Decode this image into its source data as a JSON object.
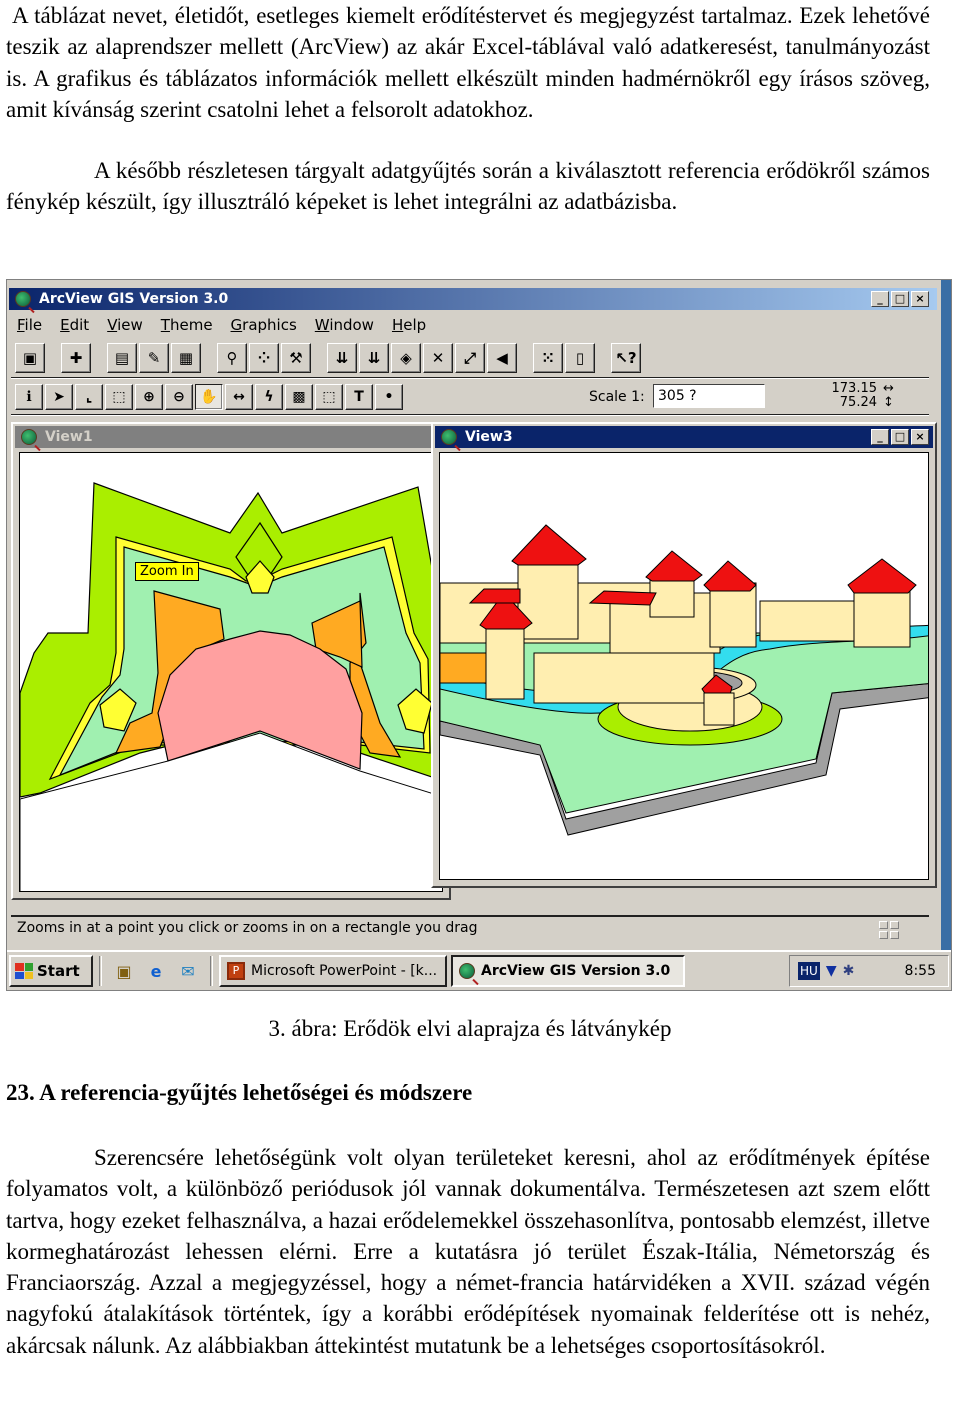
{
  "document": {
    "paragraph1": "A táblázat nevet, életidőt, esetleges kiemelt erődítéstervet és megjegyzést tartalmaz. Ezek lehetővé teszik az alaprendszer mellett (ArcView) az akár Excel-táblával való adatkeresést, tanulmányozást is. A grafikus és táblázatos információk mellett elkészült minden hadmérnökről egy írásos szöveg, amit kívánság szerint csatolni lehet a felsorolt adatokhoz.",
    "paragraph2": "A később részletesen tárgyalt adatgyűjtés során a kiválasztott referencia erődökről számos fénykép készült, így illusztráló képeket is lehet integrálni az adatbázisba.",
    "figure_caption": "3. ábra: Erődök elvi alaprajza és látványkép",
    "section_title": "23. A referencia-gyűjtés lehetőségei és módszere",
    "paragraph3": "Szerencsére lehetőségünk volt olyan területeket keresni, ahol az erődítmények építése folyamatos volt, a különböző periódusok jól vannak dokumentálva. Természetesen azt szem előtt tartva, hogy ezeket felhasználva, a hazai erődelemekkel összehasonlítva, pontosabb elemzést, illetve kormeghatározást lehessen elérni. Erre a kutatásra jó terület Észak-Itália, Németország és Franciaország. Azzal a megjegyzéssel, hogy a német-francia határvidéken a XVII. század végén nagyfokú átalakítások történtek, így a korábbi erődépítések nyomainak felderítése ott is nehéz, akárcsak nálunk. Az alábbiakban áttekintést mutatunk be a lehetséges csoportosításokról."
  },
  "arcview": {
    "title": "ArcView GIS Version 3.0",
    "caption_buttons": {
      "minimize": "_",
      "maximize": "□",
      "close": "×"
    },
    "menu": [
      "File",
      "Edit",
      "View",
      "Theme",
      "Graphics",
      "Window",
      "Help"
    ],
    "menu_mnemonics": [
      "F",
      "E",
      "V",
      "T",
      "G",
      "W",
      "H"
    ],
    "toolbar1": [
      {
        "name": "save",
        "glyph": "▣"
      },
      {
        "name": "add-theme",
        "glyph": "✚"
      },
      {
        "name": "theme-properties",
        "glyph": "▤"
      },
      {
        "name": "edit-legend",
        "glyph": "✎"
      },
      {
        "name": "open-theme-table",
        "glyph": "▦"
      },
      {
        "name": "find",
        "glyph": "⚲"
      },
      {
        "name": "locate-address",
        "glyph": "⁘"
      },
      {
        "name": "query-builder",
        "glyph": "⚒"
      },
      {
        "name": "zoom-to-full-extent",
        "glyph": "⇊"
      },
      {
        "name": "zoom-to-active-themes",
        "glyph": "⇊"
      },
      {
        "name": "zoom-to-selected",
        "glyph": "◈"
      },
      {
        "name": "zoom-in-fixed",
        "glyph": "✕"
      },
      {
        "name": "zoom-out-fixed",
        "glyph": "⤢"
      },
      {
        "name": "zoom-previous",
        "glyph": "◀"
      },
      {
        "name": "select-features-using-graphic",
        "glyph": "⁙"
      },
      {
        "name": "clear-selected-features",
        "glyph": "▯"
      },
      {
        "name": "help",
        "glyph": "↖?"
      }
    ],
    "toolbar2": [
      {
        "name": "identify",
        "glyph": "ℹ"
      },
      {
        "name": "pointer",
        "glyph": "➤"
      },
      {
        "name": "vertex-edit",
        "glyph": "⌞"
      },
      {
        "name": "select-feature",
        "glyph": "⬚"
      },
      {
        "name": "zoom-in",
        "glyph": "⊕"
      },
      {
        "name": "zoom-out",
        "glyph": "⊖"
      },
      {
        "name": "pan",
        "glyph": "✋"
      },
      {
        "name": "measure",
        "glyph": "↔"
      },
      {
        "name": "hot-link",
        "glyph": "ϟ"
      },
      {
        "name": "label",
        "glyph": "▩"
      },
      {
        "name": "text-label",
        "glyph": "⬚"
      },
      {
        "name": "text",
        "glyph": "T"
      },
      {
        "name": "draw-point",
        "glyph": "•"
      }
    ],
    "scale_label": "Scale 1:",
    "scale_value": "305   ?",
    "coord_x": "173.15",
    "coord_y": "75.24",
    "tooltip": "Zoom In",
    "view1_title": "View1",
    "view3_title": "View3",
    "status_text": "Zooms in at a point you click or zooms in on a rectangle you drag"
  },
  "taskbar": {
    "start_label": "Start",
    "tasks": [
      "Microsoft PowerPoint - [k...",
      "ArcView GIS Version 3.0"
    ],
    "tray_language": "HU",
    "clock": "8:55"
  },
  "colors": {
    "titlebar_active": "#0a246a",
    "titlebar_inactive": "#808080",
    "window_face": "#d4d0c8",
    "tooltip_bg": "#ffff00",
    "fort_lime": "#aaee00",
    "fort_mint": "#a0f0b0",
    "fort_yellow": "#ffff33",
    "fort_orange": "#ffaa22",
    "fort_pink": "#ffa0a0",
    "castle_roof": "#ee1111",
    "castle_wall": "#ffeeb0",
    "castle_water": "#33ddee",
    "castle_ground": "#a0f0b0",
    "castle_base": "#a0a0a0"
  }
}
